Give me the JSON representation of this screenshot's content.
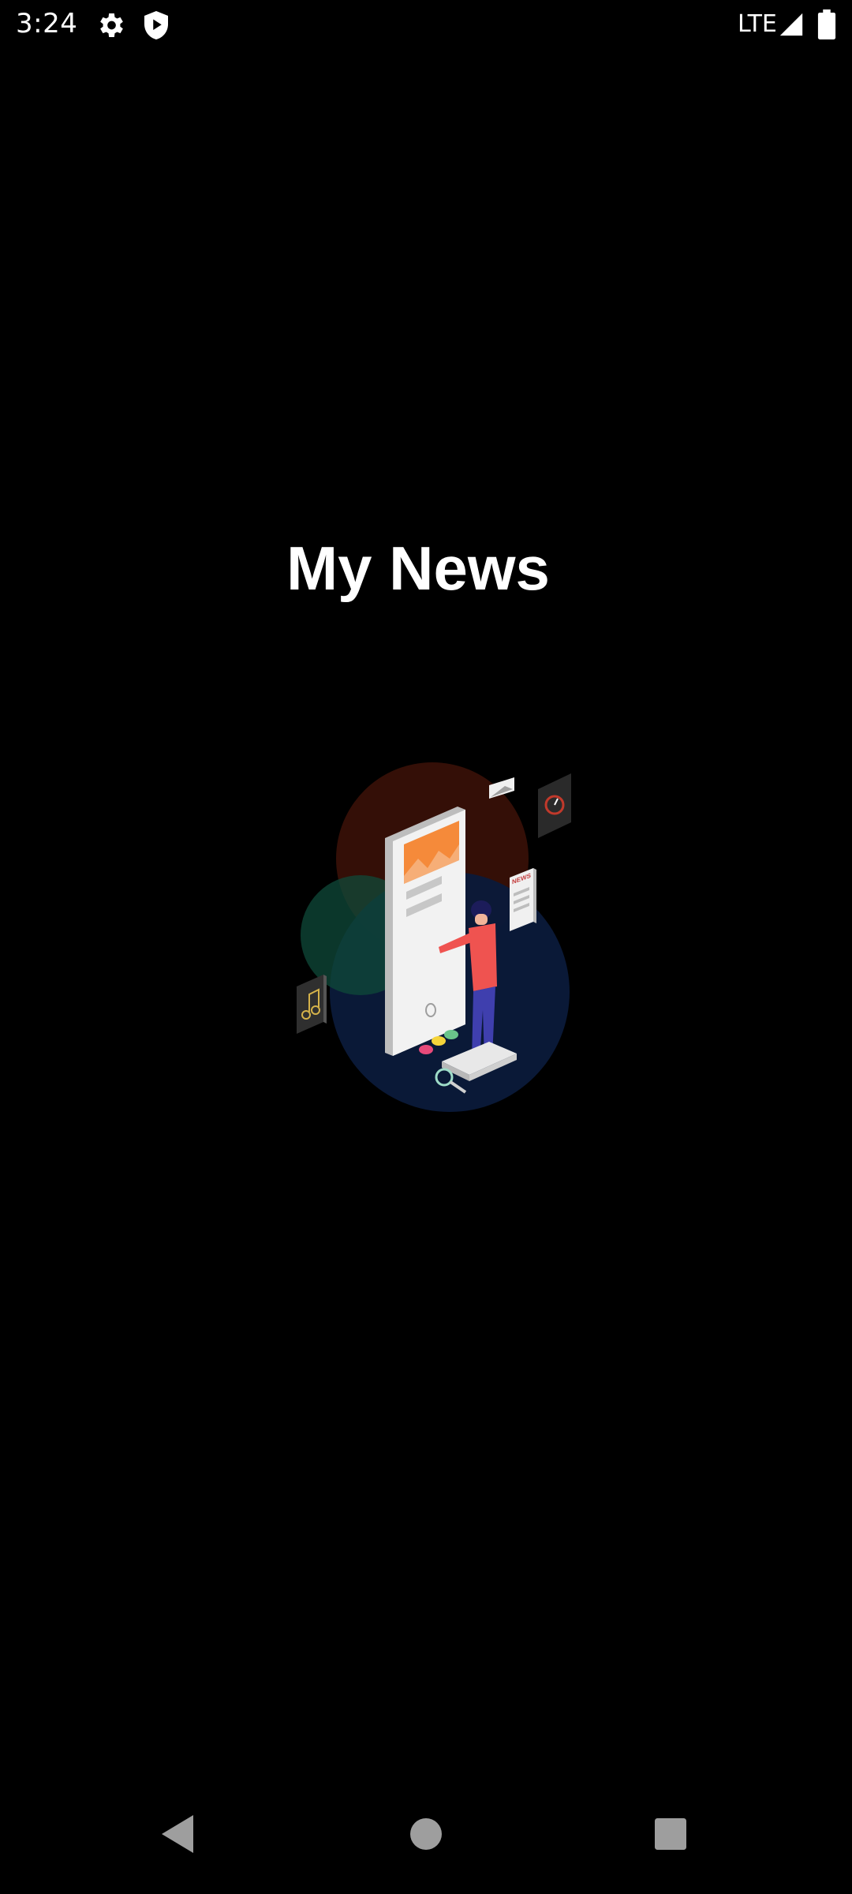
{
  "status_bar": {
    "time": "3:24",
    "network": "LTE",
    "icons": [
      "gear-icon",
      "shield-icon",
      "signal-icon",
      "battery-icon"
    ]
  },
  "app": {
    "title": "My News",
    "illustration": {
      "newspaper_text": "NEWS"
    }
  },
  "nav_bar": {
    "buttons": [
      "back",
      "home",
      "recents"
    ]
  },
  "colors": {
    "background": "#000000",
    "text": "#ffffff",
    "nav": "#9e9e9e",
    "accent_orange": "#f58a3a",
    "person_shirt": "#ef5350",
    "person_pants": "#3f3fae"
  }
}
